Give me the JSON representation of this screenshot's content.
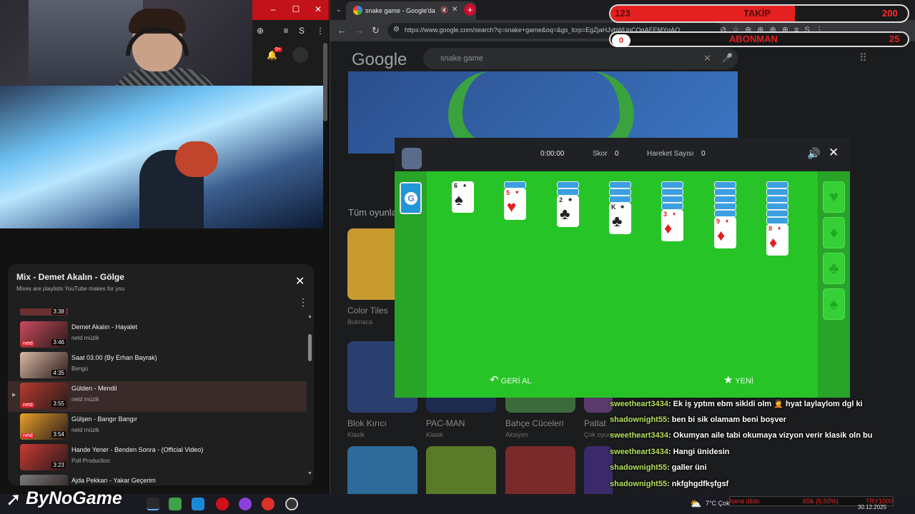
{
  "playlist": {
    "title": "Mix - Demet Akalın - Gölge",
    "subtitle": "Mixes are playlists YouTube makes for you",
    "items": [
      {
        "title": "Demet Akalın - Hayalet",
        "channel": "netd müzik",
        "duration": "3:46"
      },
      {
        "title": "Saat 03.00 (By Erhan Bayrak)",
        "channel": "Bengü",
        "duration": "4:35"
      },
      {
        "title": "Gülden - Mendil",
        "channel": "netd müzik",
        "duration": "3:55"
      },
      {
        "title": "Gülşen - Bangır Bangır",
        "channel": "netd müzik",
        "duration": "3:54"
      },
      {
        "title": "Hande Yener - Benden Sonra - (Official Video)",
        "channel": "Poll Production",
        "duration": "3:23"
      },
      {
        "title": "Ajda Pekkan - Yakar Geçerim",
        "channel": "",
        "duration": ""
      }
    ],
    "partial_top_duration": "3:38",
    "netd": "netd"
  },
  "yt": {
    "notif": "9+"
  },
  "browser": {
    "tab_title": "snake game - Google'da Ara",
    "url": "https://www.google.com/search?q=snake+game&oq=&gs_lcrp=EgZjaHJvbWUqCQgAEEMYgAQ...",
    "search_query": "snake game",
    "logo": "Google",
    "section_title": "Tüm oyunlar",
    "cards": [
      {
        "label": "Color Tiles",
        "sub": "Bulmaca"
      },
      {
        "label": "Blok Kırıcı",
        "sub": "Klasik"
      },
      {
        "label": "PAC-MAN",
        "sub": "Klasik"
      },
      {
        "label": "Bahçe Cüceleri",
        "sub": "Aksiyon"
      },
      {
        "label": "Patlat",
        "sub": "Çok oyunculu"
      }
    ]
  },
  "game": {
    "time": "0:00:00",
    "score_label": "Skor",
    "score": "0",
    "moves_label": "Hareket Sayısı",
    "moves": "0",
    "undo": "GERİ AL",
    "new": "YENİ",
    "stock_glyph": "G",
    "columns": [
      {
        "down": 0,
        "rank": "6",
        "suit": "♠",
        "color": "black"
      },
      {
        "down": 1,
        "rank": "5",
        "suit": "♥",
        "color": "red"
      },
      {
        "down": 2,
        "rank": "2",
        "suit": "♣",
        "color": "black"
      },
      {
        "down": 3,
        "rank": "K",
        "suit": "♣",
        "color": "black"
      },
      {
        "down": 4,
        "rank": "3",
        "suit": "♦",
        "color": "red"
      },
      {
        "down": 5,
        "rank": "9",
        "suit": "♦",
        "color": "red"
      },
      {
        "down": 6,
        "rank": "8",
        "suit": "♦",
        "color": "red"
      }
    ],
    "foundations": [
      "♥",
      "♦",
      "♣",
      "♠"
    ]
  },
  "overlay": {
    "follow_count": "123",
    "follow_label": "TAKİP",
    "follow_goal": "200",
    "follow_progress": 0.62,
    "sub_count": "0",
    "sub_label": "ABONMAN",
    "sub_goal": "25"
  },
  "chat": [
    {
      "user": "sweetheart3434",
      "msg": ": Ek iş yptım ebm sikldi olm 🤦 hyat laylaylom dgl ki"
    },
    {
      "user": "shadownight55",
      "msg": ": ben bi sik olamam beni boşver"
    },
    {
      "user": "sweetheart3434",
      "msg": ": Okumyan aile tabi okumaya vizyon verir klasik oln bu"
    },
    {
      "user": "sweetheart3434",
      "msg": ": Hangi ünidesin"
    },
    {
      "user": "shadownight55",
      "msg": ": galler üni"
    },
    {
      "user": "shadownight55",
      "msg": ": nkfghgdfkşfgsf"
    }
  ],
  "taskbar": {
    "logo": "ByNoGame",
    "weather": "7°C  Çok",
    "donation_text": "bana dildo",
    "stock": "65₺ (6.50%)",
    "currency": "TRY1000",
    "date": "30.12.2025"
  },
  "colors": {
    "game_green": "#27c427",
    "follow_red": "#e52020",
    "chat_user": "#b7e05a"
  }
}
